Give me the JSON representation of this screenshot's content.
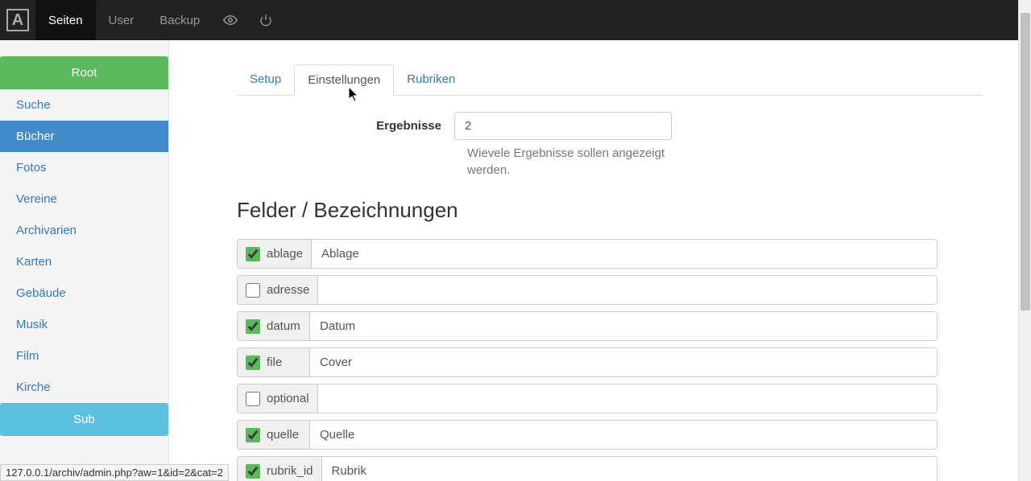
{
  "topnav": {
    "brand_glyph": "A",
    "items": [
      {
        "label": "Seiten",
        "active": true
      },
      {
        "label": "User",
        "active": false
      },
      {
        "label": "Backup",
        "active": false
      }
    ],
    "icons": [
      "eye-icon",
      "power-icon"
    ]
  },
  "sidebar": {
    "root_label": "Root",
    "items": [
      {
        "label": "Suche",
        "selected": false
      },
      {
        "label": "Bücher",
        "selected": true
      },
      {
        "label": "Fotos",
        "selected": false
      },
      {
        "label": "Vereine",
        "selected": false
      },
      {
        "label": "Archivarien",
        "selected": false
      },
      {
        "label": "Karten",
        "selected": false
      },
      {
        "label": "Gebäude",
        "selected": false
      },
      {
        "label": "Musik",
        "selected": false
      },
      {
        "label": "Film",
        "selected": false
      },
      {
        "label": "Kirche",
        "selected": false
      }
    ],
    "sub_label": "Sub"
  },
  "tabs": [
    {
      "label": "Setup",
      "active": false
    },
    {
      "label": "Einstellungen",
      "active": true
    },
    {
      "label": "Rubriken",
      "active": false
    }
  ],
  "form": {
    "ergebnisse_label": "Ergebnisse",
    "ergebnisse_value": "2",
    "ergebnisse_help": "Wievele Ergebnisse sollen angezeigt werden."
  },
  "section_title": "Felder / Bezeichnungen",
  "fields": [
    {
      "key": "ablage",
      "checked": true,
      "value": "Ablage"
    },
    {
      "key": "adresse",
      "checked": false,
      "value": ""
    },
    {
      "key": "datum",
      "checked": true,
      "value": "Datum"
    },
    {
      "key": "file",
      "checked": true,
      "value": "Cover"
    },
    {
      "key": "optional",
      "checked": false,
      "value": ""
    },
    {
      "key": "quelle",
      "checked": true,
      "value": "Quelle"
    },
    {
      "key": "rubrik_id",
      "checked": true,
      "value": "Rubrik"
    }
  ],
  "status_url": "127.0.0.1/archiv/admin.php?aw=1&id=2&cat=2"
}
